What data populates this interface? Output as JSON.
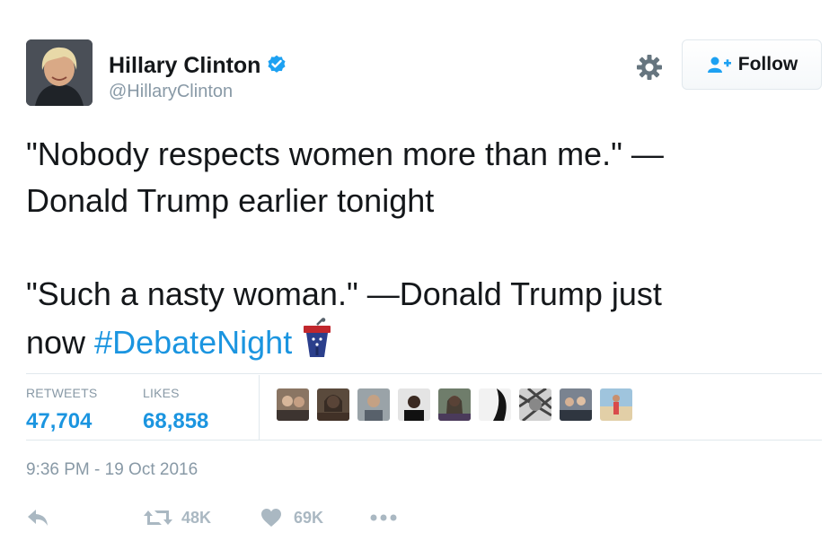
{
  "header": {
    "name": "Hillary Clinton",
    "handle": "@HillaryClinton",
    "follow_label": "Follow",
    "avatar_icon": "person-avatar",
    "verified_icon": "verified-badge-icon"
  },
  "tweet": {
    "line1": "\"Nobody respects women more than me.\" —",
    "line2": "Donald Trump earlier tonight",
    "line3": "\"Such a nasty woman.\" —Donald Trump just",
    "line4_prefix": "now ",
    "hashtag": "#DebateNight",
    "emoji_icon": "debate-podium-icon"
  },
  "stats": {
    "retweets_label": "RETWEETS",
    "retweets_value": "47,704",
    "likes_label": "LIKES",
    "likes_value": "68,858",
    "liker_count": 9
  },
  "timestamp": "9:36 PM - 19 Oct 2016",
  "actions": {
    "reply_icon": "reply-icon",
    "retweet_icon": "retweet-icon",
    "retweet_count": "48K",
    "like_icon": "heart-icon",
    "like_count": "69K",
    "more_icon": "more-dots-icon"
  },
  "colors": {
    "accent": "#1b95e0",
    "muted": "#8899a6",
    "icon_gray": "#aab8c2",
    "text": "#14171a"
  }
}
